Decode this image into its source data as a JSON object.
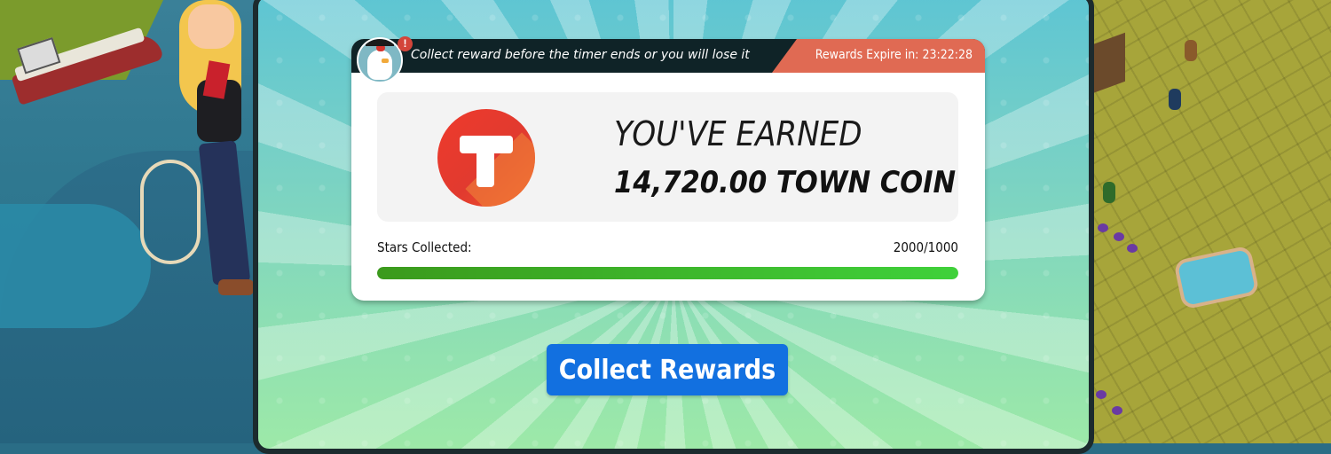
{
  "header": {
    "message": "Collect reward before the timer ends or you will lose it",
    "expire_label": "Rewards Expire in:",
    "expire_time": "23:22:28",
    "alert_glyph": "!"
  },
  "reward": {
    "earned_label": "YOU'VE EARNED",
    "amount": "14,720.00 TOWN COIN",
    "coin_icon": "town-coin-icon"
  },
  "stars": {
    "label": "Stars Collected:",
    "value": "2000/1000",
    "progress_fraction": 1.0
  },
  "actions": {
    "collect_label": "Collect Rewards"
  },
  "colors": {
    "header_bg": "#0f2327",
    "expire_tab": "#e06a53",
    "coin_red": "#e13a2f",
    "progress_green": "#3fd13a",
    "button_blue": "#1270e0"
  }
}
